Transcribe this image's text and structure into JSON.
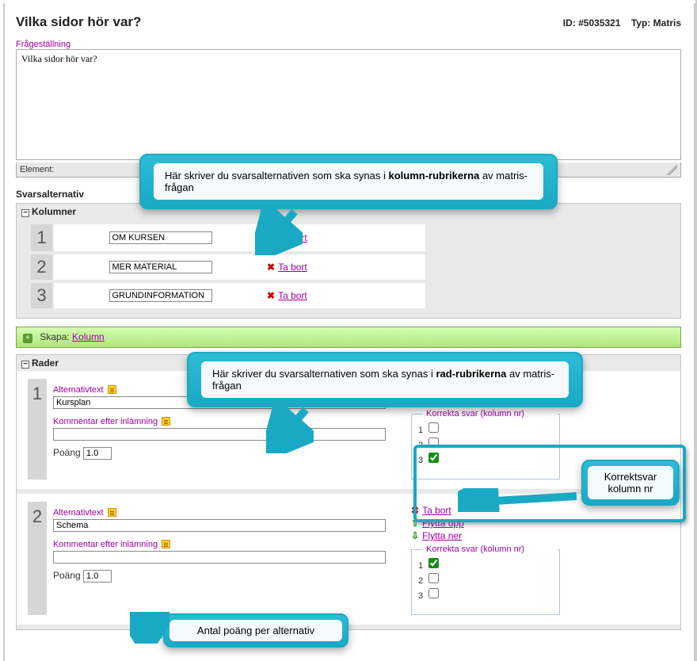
{
  "header": {
    "title": "Vilka sidor hör var?",
    "id_label": "ID:",
    "id_value": "#5035321",
    "type_label": "Typ:",
    "type_value": "Matris"
  },
  "question": {
    "label": "Frågeställning",
    "value": "Vilka sidor hör var?",
    "element_label": "Element:"
  },
  "answers": {
    "section_label": "Svarsalternativ",
    "columns_header": "Kolumner",
    "rows_header": "Rader",
    "remove_label": "Ta bort",
    "create_label": "Skapa:",
    "create_link": "Kolumn"
  },
  "columns": [
    {
      "num": "1",
      "value": "OM KURSEN"
    },
    {
      "num": "2",
      "value": "MER MATERIAL"
    },
    {
      "num": "3",
      "value": "GRUNDINFORMATION"
    }
  ],
  "row_labels": {
    "alt_text": "Alternativtext",
    "comment_after": "Kommentar efter inlämning",
    "points": "Poäng",
    "remove": "Ta bort",
    "move_down": "Flytta ner",
    "move_up": "Flytta upp",
    "correct_header": "Korrekta svar (kolumn nr)"
  },
  "rows": [
    {
      "num": "1",
      "alt": "Kursplan",
      "comment": "",
      "points": "1.0",
      "correct": [
        {
          "n": "1",
          "checked": false
        },
        {
          "n": "2",
          "checked": false
        },
        {
          "n": "3",
          "checked": true
        }
      ],
      "actions": [
        "remove",
        "down"
      ]
    },
    {
      "num": "2",
      "alt": "Schema",
      "comment": "",
      "points": "1.0",
      "correct": [
        {
          "n": "1",
          "checked": true
        },
        {
          "n": "2",
          "checked": false
        },
        {
          "n": "3",
          "checked": false
        }
      ],
      "actions": [
        "remove",
        "up",
        "down"
      ]
    }
  ],
  "callouts": {
    "c1_a": "Här skriver du svarsalternativen som ska synas i ",
    "c1_b": "kolumn-rubrikerna",
    "c1_c": " av matris-frågan",
    "c2_a": "Här skriver du svarsalternativen som ska synas i ",
    "c2_b": "rad-rubrikerna",
    "c2_c": " av matris-frågan",
    "c3_a": "Korrektsvar",
    "c3_b": "kolumn nr",
    "c4": "Antal poäng per alternativ"
  }
}
